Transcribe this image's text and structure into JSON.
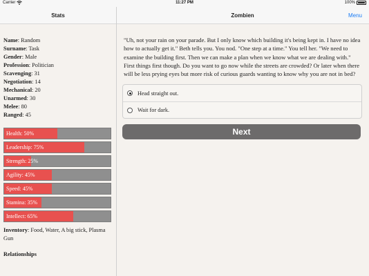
{
  "statusbar": {
    "carrier": "Carrier",
    "time": "11:27 PM",
    "battery": "100%"
  },
  "navbar": {
    "left_title": "Stats",
    "center_title": "Zombien",
    "menu_label": "Menu"
  },
  "stats": [
    {
      "label": "Name",
      "value": "Random"
    },
    {
      "label": "Surname",
      "value": "Task"
    },
    {
      "label": "Gender",
      "value": "Male"
    },
    {
      "label": "Profession",
      "value": "Politician"
    },
    {
      "label": "Scavenging",
      "value": "31"
    },
    {
      "label": "Negotiation",
      "value": "14"
    },
    {
      "label": "Mechanical",
      "value": "20"
    },
    {
      "label": "Unarmed",
      "value": "30"
    },
    {
      "label": "Melee",
      "value": "80"
    },
    {
      "label": "Ranged",
      "value": "45"
    }
  ],
  "bars": [
    {
      "text": "Health: 50%",
      "percent": 50
    },
    {
      "text": "Leadership: 75%",
      "percent": 75
    },
    {
      "text": "Strength: 25%",
      "percent": 25
    },
    {
      "text": "Agility: 45%",
      "percent": 45
    },
    {
      "text": "Speed: 45%",
      "percent": 45
    },
    {
      "text": "Stamina: 35%",
      "percent": 35
    },
    {
      "text": "Intellect: 65%",
      "percent": 65
    }
  ],
  "colors": {
    "bar_fill": "#e8514f",
    "bar_bg": "#8f8f8f",
    "accent": "#1a7cf5",
    "next_button": "#6d6b6b"
  },
  "inventory": {
    "label": "Inventory",
    "value": "Food, Water, A big stick, Plasma Gun"
  },
  "relationships_label": "Relationships",
  "story": "\"Uh, not your rain on your parade. But I only know which building it's being kept in. I have no idea how to actually get it.\" Beth tells you. You nod. \"One step at a time.\" You tell her. \"We need to examine the building first. Then we can make a plan when we know what we are dealing with.\" First things first though. Do you want to go now while the streets are crowded? Or later when there will be less prying eyes but more risk of curious guards wanting to know why you are not in bed?",
  "options": [
    {
      "label": "Head straight out.",
      "selected": true
    },
    {
      "label": "Wait for dark.",
      "selected": false
    }
  ],
  "next_label": "Next"
}
